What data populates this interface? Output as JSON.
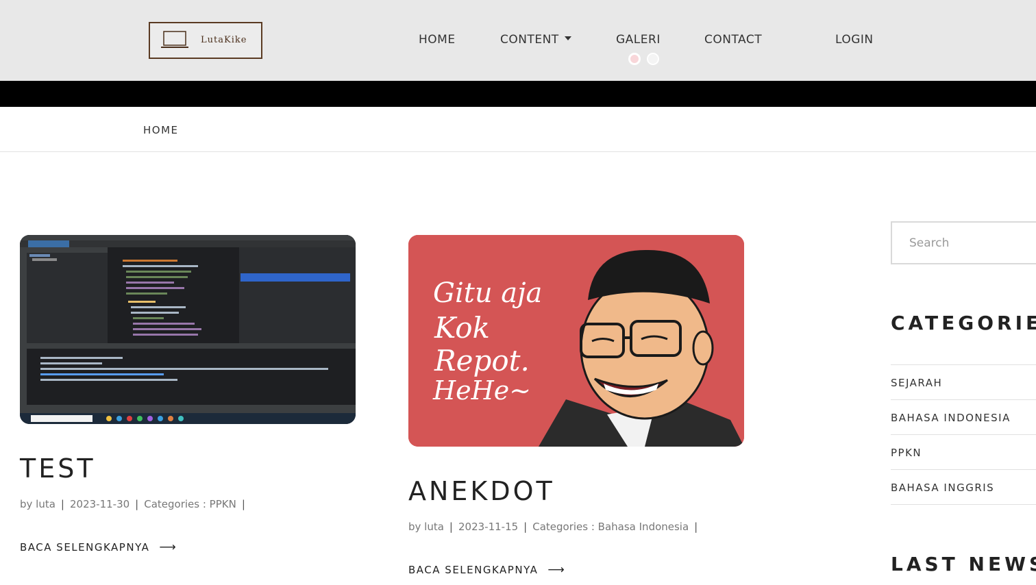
{
  "header": {
    "logo_text": "LutaKike",
    "nav": {
      "home": "HOME",
      "content": "CONTENT",
      "galeri": "GALERI",
      "contact": "CONTACT",
      "login": "LOGIN"
    }
  },
  "breadcrumb": {
    "home": "HOME"
  },
  "posts": [
    {
      "title": "TEST",
      "author": "by luta",
      "date": "2023-11-30",
      "category": "Categories : PPKN",
      "read_more": "BACA SELENGKAPNYA",
      "image": "ide-screenshot"
    },
    {
      "title": "ANEKDOT",
      "author": "by luta",
      "date": "2023-11-15",
      "category": "Categories : Bahasa Indonesia",
      "read_more": "BACA SELENGKAPNYA",
      "image": "cartoon-illustration",
      "image_text": [
        "Gitu aja",
        "Kok",
        "Repot.",
        "HeHe~"
      ]
    }
  ],
  "sidebar": {
    "search_placeholder": "Search",
    "categories_title": "CATEGORIES",
    "categories": [
      "SEJARAH",
      "BAHASA INDONESIA",
      "PPKN",
      "BAHASA INGGRIS"
    ],
    "last_news_title": "LAST NEWS"
  },
  "colors": {
    "header_bg": "#e8e8e8",
    "band": "#000000",
    "logo_border": "#5a3a22",
    "anekdot_bg": "#d45555"
  }
}
